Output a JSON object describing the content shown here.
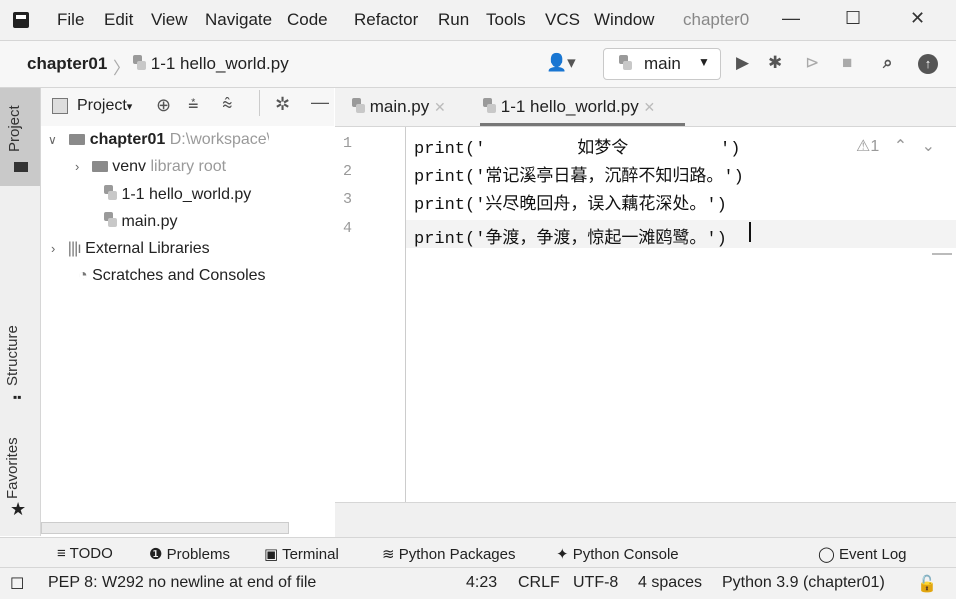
{
  "menubar": {
    "items": [
      "File",
      "Edit",
      "View",
      "Navigate",
      "Code",
      "Refactor",
      "Run",
      "Tools",
      "VCS",
      "Window"
    ],
    "project_title": "chapter0"
  },
  "navbar": {
    "breadcrumb_project": "chapter01",
    "breadcrumb_file": "1-1 hello_world.py",
    "run_config": "main"
  },
  "sidebar": {
    "tabs": [
      "Project",
      "Structure",
      "Favorites"
    ]
  },
  "project_panel": {
    "title": "Project",
    "root_name": "chapter01",
    "root_path": "D:\\workspace\\chap",
    "items": [
      {
        "name": "venv",
        "note": "library root"
      },
      {
        "name": "1-1 hello_world.py"
      },
      {
        "name": "main.py"
      },
      {
        "name": "External Libraries"
      },
      {
        "name": "Scratches and Consoles"
      }
    ]
  },
  "editor": {
    "tabs": [
      "main.py",
      "1-1 hello_world.py"
    ],
    "active_tab": "1-1 hello_world.py",
    "line_numbers": [
      "1",
      "2",
      "3",
      "4"
    ],
    "lines": [
      "print('         如梦令         ')",
      "print('常记溪亭日暮，沉醉不知归路。')",
      "print('兴尽晚回舟，误入藕花深处。')",
      "print('争渡，争渡，惊起一滩鸥鹭。')"
    ],
    "warnings_count": "1"
  },
  "tool_windows": {
    "todo": "TODO",
    "problems": "Problems",
    "terminal": "Terminal",
    "python_packages": "Python Packages",
    "python_console": "Python Console",
    "event_log": "Event Log"
  },
  "statusbar": {
    "message": "PEP 8: W292 no newline at end of file",
    "position": "4:23",
    "line_ending": "CRLF",
    "encoding": "UTF-8",
    "indent": "4 spaces",
    "interpreter": "Python 3.9 (chapter01)"
  }
}
